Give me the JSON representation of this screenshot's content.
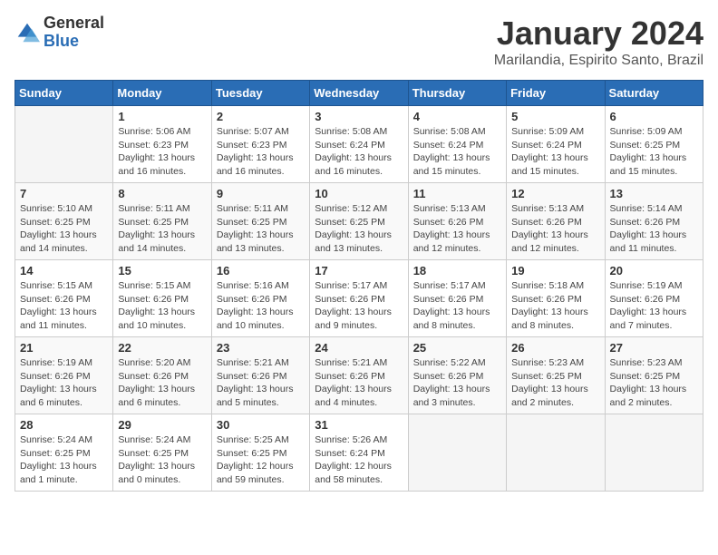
{
  "logo": {
    "general": "General",
    "blue": "Blue"
  },
  "title": "January 2024",
  "subtitle": "Marilandia, Espirito Santo, Brazil",
  "weekdays": [
    "Sunday",
    "Monday",
    "Tuesday",
    "Wednesday",
    "Thursday",
    "Friday",
    "Saturday"
  ],
  "weeks": [
    [
      {
        "day": "",
        "info": ""
      },
      {
        "day": "1",
        "info": "Sunrise: 5:06 AM\nSunset: 6:23 PM\nDaylight: 13 hours and 16 minutes."
      },
      {
        "day": "2",
        "info": "Sunrise: 5:07 AM\nSunset: 6:23 PM\nDaylight: 13 hours and 16 minutes."
      },
      {
        "day": "3",
        "info": "Sunrise: 5:08 AM\nSunset: 6:24 PM\nDaylight: 13 hours and 16 minutes."
      },
      {
        "day": "4",
        "info": "Sunrise: 5:08 AM\nSunset: 6:24 PM\nDaylight: 13 hours and 15 minutes."
      },
      {
        "day": "5",
        "info": "Sunrise: 5:09 AM\nSunset: 6:24 PM\nDaylight: 13 hours and 15 minutes."
      },
      {
        "day": "6",
        "info": "Sunrise: 5:09 AM\nSunset: 6:25 PM\nDaylight: 13 hours and 15 minutes."
      }
    ],
    [
      {
        "day": "7",
        "info": "Sunrise: 5:10 AM\nSunset: 6:25 PM\nDaylight: 13 hours and 14 minutes."
      },
      {
        "day": "8",
        "info": "Sunrise: 5:11 AM\nSunset: 6:25 PM\nDaylight: 13 hours and 14 minutes."
      },
      {
        "day": "9",
        "info": "Sunrise: 5:11 AM\nSunset: 6:25 PM\nDaylight: 13 hours and 13 minutes."
      },
      {
        "day": "10",
        "info": "Sunrise: 5:12 AM\nSunset: 6:25 PM\nDaylight: 13 hours and 13 minutes."
      },
      {
        "day": "11",
        "info": "Sunrise: 5:13 AM\nSunset: 6:26 PM\nDaylight: 13 hours and 12 minutes."
      },
      {
        "day": "12",
        "info": "Sunrise: 5:13 AM\nSunset: 6:26 PM\nDaylight: 13 hours and 12 minutes."
      },
      {
        "day": "13",
        "info": "Sunrise: 5:14 AM\nSunset: 6:26 PM\nDaylight: 13 hours and 11 minutes."
      }
    ],
    [
      {
        "day": "14",
        "info": "Sunrise: 5:15 AM\nSunset: 6:26 PM\nDaylight: 13 hours and 11 minutes."
      },
      {
        "day": "15",
        "info": "Sunrise: 5:15 AM\nSunset: 6:26 PM\nDaylight: 13 hours and 10 minutes."
      },
      {
        "day": "16",
        "info": "Sunrise: 5:16 AM\nSunset: 6:26 PM\nDaylight: 13 hours and 10 minutes."
      },
      {
        "day": "17",
        "info": "Sunrise: 5:17 AM\nSunset: 6:26 PM\nDaylight: 13 hours and 9 minutes."
      },
      {
        "day": "18",
        "info": "Sunrise: 5:17 AM\nSunset: 6:26 PM\nDaylight: 13 hours and 8 minutes."
      },
      {
        "day": "19",
        "info": "Sunrise: 5:18 AM\nSunset: 6:26 PM\nDaylight: 13 hours and 8 minutes."
      },
      {
        "day": "20",
        "info": "Sunrise: 5:19 AM\nSunset: 6:26 PM\nDaylight: 13 hours and 7 minutes."
      }
    ],
    [
      {
        "day": "21",
        "info": "Sunrise: 5:19 AM\nSunset: 6:26 PM\nDaylight: 13 hours and 6 minutes."
      },
      {
        "day": "22",
        "info": "Sunrise: 5:20 AM\nSunset: 6:26 PM\nDaylight: 13 hours and 6 minutes."
      },
      {
        "day": "23",
        "info": "Sunrise: 5:21 AM\nSunset: 6:26 PM\nDaylight: 13 hours and 5 minutes."
      },
      {
        "day": "24",
        "info": "Sunrise: 5:21 AM\nSunset: 6:26 PM\nDaylight: 13 hours and 4 minutes."
      },
      {
        "day": "25",
        "info": "Sunrise: 5:22 AM\nSunset: 6:26 PM\nDaylight: 13 hours and 3 minutes."
      },
      {
        "day": "26",
        "info": "Sunrise: 5:23 AM\nSunset: 6:25 PM\nDaylight: 13 hours and 2 minutes."
      },
      {
        "day": "27",
        "info": "Sunrise: 5:23 AM\nSunset: 6:25 PM\nDaylight: 13 hours and 2 minutes."
      }
    ],
    [
      {
        "day": "28",
        "info": "Sunrise: 5:24 AM\nSunset: 6:25 PM\nDaylight: 13 hours and 1 minute."
      },
      {
        "day": "29",
        "info": "Sunrise: 5:24 AM\nSunset: 6:25 PM\nDaylight: 13 hours and 0 minutes."
      },
      {
        "day": "30",
        "info": "Sunrise: 5:25 AM\nSunset: 6:25 PM\nDaylight: 12 hours and 59 minutes."
      },
      {
        "day": "31",
        "info": "Sunrise: 5:26 AM\nSunset: 6:24 PM\nDaylight: 12 hours and 58 minutes."
      },
      {
        "day": "",
        "info": ""
      },
      {
        "day": "",
        "info": ""
      },
      {
        "day": "",
        "info": ""
      }
    ]
  ]
}
